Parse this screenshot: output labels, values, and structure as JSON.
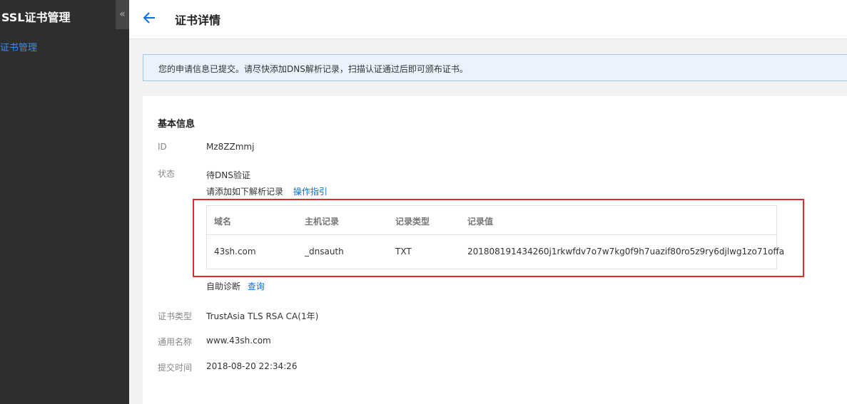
{
  "sidebar": {
    "title": "SSL证书管理",
    "collapse_icon": "«",
    "items": [
      {
        "label": "证书管理"
      }
    ]
  },
  "header": {
    "back_icon": "arrow-left-icon",
    "title": "证书详情"
  },
  "notice": {
    "text": "您的申请信息已提交。请尽快添加DNS解析记录，扫描认证通过后即可颁布证书。"
  },
  "basic": {
    "section_title": "基本信息",
    "id_label": "ID",
    "id_value": "Mz8ZZmmj",
    "status_label": "状态",
    "status_value": "待DNS验证",
    "add_record_text": "请添加如下解析记录",
    "guide_link": "操作指引",
    "dns_table": {
      "columns": [
        "域名",
        "主机记录",
        "记录类型",
        "记录值"
      ],
      "rows": [
        [
          "43sh.com",
          "_dnsauth",
          "TXT",
          "201808191434260j1rkwfdv7o7w7kg0f9h7uazif80ro5z9ry6djlwg1zo71offa"
        ]
      ]
    },
    "self_diag_text": "自助诊断",
    "query_link": "查询",
    "cert_type_label": "证书类型",
    "cert_type_value": "TrustAsia TLS RSA CA(1年)",
    "common_name_label": "通用名称",
    "common_name_value": "www.43sh.com",
    "submit_time_label": "提交时间",
    "submit_time_value": "2018-08-20 22:34:26"
  },
  "colors": {
    "accent": "#0a6ee6",
    "sidebar_bg": "#2e2e2e",
    "highlight": "#e02a2a",
    "notice_bg": "#eaf3fd"
  }
}
